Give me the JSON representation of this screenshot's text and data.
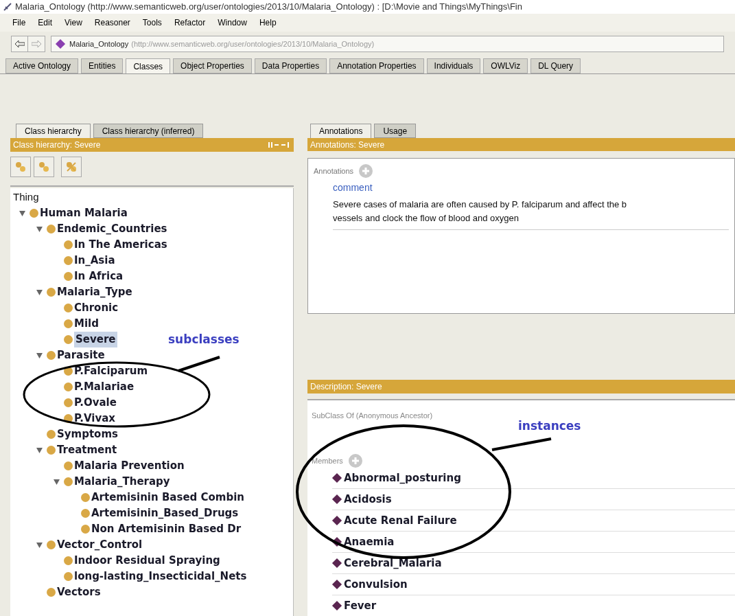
{
  "window": {
    "title": "Malaria_Ontology (http://www.semanticweb.org/user/ontologies/2013/10/Malaria_Ontology) : [D:\\Movie and Things\\MyThings\\Fin"
  },
  "menu": [
    "File",
    "Edit",
    "View",
    "Reasoner",
    "Tools",
    "Refactor",
    "Window",
    "Help"
  ],
  "address": {
    "name": "Malaria_Ontology",
    "iri": "(http://www.semanticweb.org/user/ontologies/2013/10/Malaria_Ontology)"
  },
  "tabs": [
    {
      "label": "Active Ontology",
      "selected": false
    },
    {
      "label": "Entities",
      "selected": false
    },
    {
      "label": "Classes",
      "selected": true
    },
    {
      "label": "Object Properties",
      "selected": false
    },
    {
      "label": "Data Properties",
      "selected": false
    },
    {
      "label": "Annotation Properties",
      "selected": false
    },
    {
      "label": "Individuals",
      "selected": false
    },
    {
      "label": "OWLViz",
      "selected": false
    },
    {
      "label": "DL Query",
      "selected": false
    }
  ],
  "left": {
    "tabs": [
      {
        "label": "Class hierarchy",
        "selected": true
      },
      {
        "label": "Class hierarchy (inferred)",
        "selected": false
      }
    ],
    "header": "Class hierarchy: Severe",
    "tree": {
      "label": "Thing",
      "selected": false,
      "children": [
        {
          "label": "Human Malaria",
          "selected": false,
          "expanded": true,
          "children": [
            {
              "label": "Endemic_Countries",
              "selected": false,
              "expanded": true,
              "children": [
                {
                  "label": "In The Americas",
                  "selected": false
                },
                {
                  "label": "In_Asia",
                  "selected": false
                },
                {
                  "label": "In Africa",
                  "selected": false
                }
              ]
            },
            {
              "label": "Malaria_Type",
              "selected": false,
              "expanded": true,
              "children": [
                {
                  "label": "Chronic",
                  "selected": false
                },
                {
                  "label": "Mild",
                  "selected": false
                },
                {
                  "label": "Severe",
                  "selected": true
                }
              ]
            },
            {
              "label": "Parasite",
              "selected": false,
              "expanded": true,
              "children": [
                {
                  "label": "P.Falciparum",
                  "selected": false
                },
                {
                  "label": "P.Malariae",
                  "selected": false
                },
                {
                  "label": "P.Ovale",
                  "selected": false
                },
                {
                  "label": "P.Vivax",
                  "selected": false
                }
              ]
            },
            {
              "label": "Symptoms",
              "selected": false
            },
            {
              "label": "Treatment",
              "selected": false,
              "expanded": true,
              "children": [
                {
                  "label": "Malaria Prevention",
                  "selected": false
                },
                {
                  "label": "Malaria_Therapy",
                  "selected": false,
                  "expanded": true,
                  "children": [
                    {
                      "label": "Artemisinin Based Combin",
                      "selected": false
                    },
                    {
                      "label": "Artemisinin_Based_Drugs",
                      "selected": false
                    },
                    {
                      "label": "Non Artemisinin Based Dr",
                      "selected": false
                    }
                  ]
                }
              ]
            },
            {
              "label": "Vector_Control",
              "selected": false,
              "expanded": true,
              "children": [
                {
                  "label": "Indoor Residual Spraying",
                  "selected": false
                },
                {
                  "label": "long-lasting_Insecticidal_Nets",
                  "selected": false
                }
              ]
            },
            {
              "label": "Vectors",
              "selected": false
            }
          ]
        }
      ]
    }
  },
  "right": {
    "tabs": [
      {
        "label": "Annotations",
        "selected": true
      },
      {
        "label": "Usage",
        "selected": false
      }
    ],
    "header": "Annotations: Severe",
    "annotations_label": "Annotations",
    "property": "comment",
    "comment": [
      "Severe cases of malaria are often caused by P. falciparum and affect the b",
      "vessels and clock the flow of blood and oxygen"
    ],
    "description_header": "Description: Severe",
    "subclass_label": "SubClass Of (Anonymous Ancestor)",
    "members_label": "Members",
    "members": [
      "Abnormal_posturing",
      "Acidosis",
      "Acute Renal Failure",
      "Anaemia",
      "Cerebral_Malaria",
      "Convulsion",
      "Fever"
    ]
  },
  "notes": [
    {
      "text": "subclasses"
    },
    {
      "text": "instances"
    }
  ]
}
